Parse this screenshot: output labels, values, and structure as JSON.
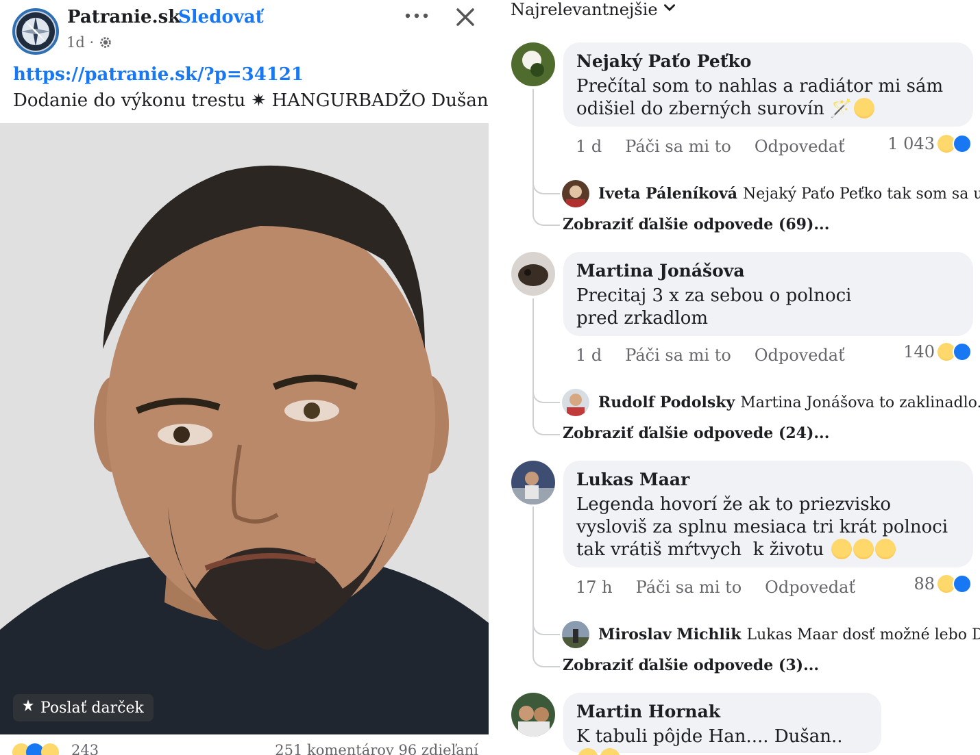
{
  "post": {
    "page_name": "Patranie.sk",
    "separator": "·",
    "follow_label": "Sledovať",
    "time": "1d ·",
    "link": "https://patranie.sk/?p=34121",
    "text": "Dodanie do výkonu trestu ✷ HANGURBADŽO Dušan",
    "gift_label": "Poslať darček",
    "reaction_count": "243",
    "stats": "251 komentárov  96 zdieľaní",
    "menu_icon": "more-icon",
    "close_icon": "close-icon"
  },
  "comments_panel": {
    "sort_label": "Najrelevantnejšie",
    "comments": [
      {
        "name": "Nejaký Paťo Peťko",
        "text": "Prečítal som to nahlas a radiátor mi sám odišiel do zberných surovín",
        "time": "1 d",
        "like_label": "Páči sa mi to",
        "reply_label": "Odpovedať",
        "reactions": "1 043",
        "reply": {
          "name": "Iveta Páleníková",
          "text": "Nejaký Paťo Peťko tak som sa už..."
        },
        "more_replies": "Zobraziť ďalšie odpovede (69)..."
      },
      {
        "name": "Martina Jonášova",
        "text": "Precitaj 3 x za sebou o polnoci pred zrkadlom",
        "time": "1 d",
        "like_label": "Páči sa mi to",
        "reply_label": "Odpovedať",
        "reactions": "140",
        "reply": {
          "name": "Rudolf Podolsky",
          "text": "Martina Jonášova to zaklinadlo..."
        },
        "more_replies": "Zobraziť ďalšie odpovede (24)..."
      },
      {
        "name": "Lukas Maar",
        "text": "Legenda hovorí že ak to priezvisko vysloviš za splnu mesiaca tri krát polnoci tak vrátiš mŕtvych  k životu",
        "time": "17 h",
        "like_label": "Páči sa mi to",
        "reply_label": "Odpovedať",
        "reactions": "88",
        "reply": {
          "name": "Miroslav Michlik",
          "text": "Lukas Maar dosť možné lebo Du..."
        },
        "more_replies": "Zobraziť ďalšie odpovede (3)..."
      },
      {
        "name": "Martin Hornak",
        "text": "K tabuli pôjde Han.... Dušan.."
      }
    ]
  },
  "colors": {
    "accent": "#1877f2",
    "bubble": "#f0f2f5",
    "muted": "#65676b"
  }
}
